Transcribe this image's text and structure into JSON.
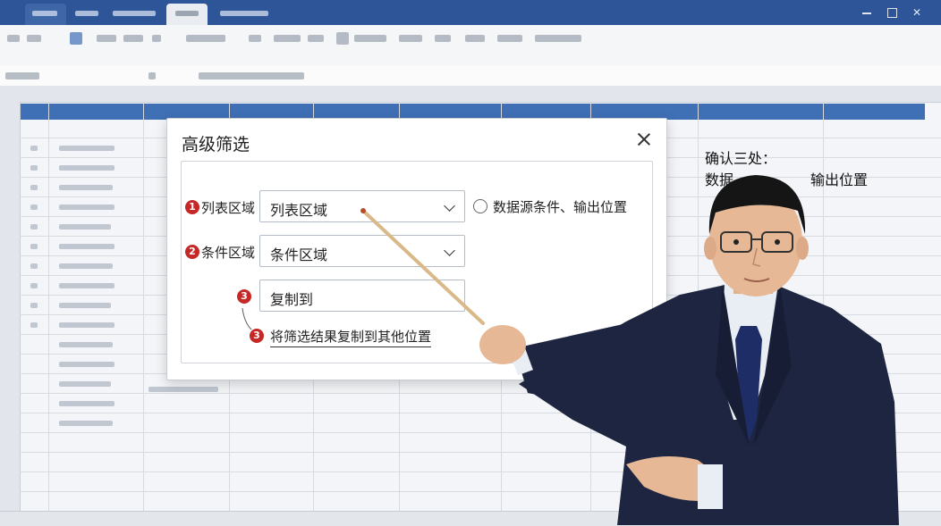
{
  "dialog": {
    "title": "高级筛选",
    "list_range": {
      "badge": "1",
      "label": "列表区域",
      "value": "列表区域"
    },
    "criteria_range": {
      "badge": "2",
      "label": "条件区域",
      "value": "条件区域"
    },
    "copy_to": {
      "badge": "3",
      "value": "复制到"
    },
    "radio_option": {
      "label": "数据源条件、输出位置"
    },
    "copy_option": {
      "badge": "3",
      "label": "将筛选结果复制到其他位置"
    }
  },
  "annotation": {
    "line1": "确认三处：",
    "line2_left": "数据",
    "line2_right": "输出位置"
  },
  "icons": [
    "close-icon",
    "chevron-down-icon",
    "radio-icon"
  ],
  "colors": {
    "ribbon_tab_bar": "#2e5597",
    "header_row": "#3f6fb5",
    "badge": "#c62828",
    "pointer": "#d9b88a"
  }
}
